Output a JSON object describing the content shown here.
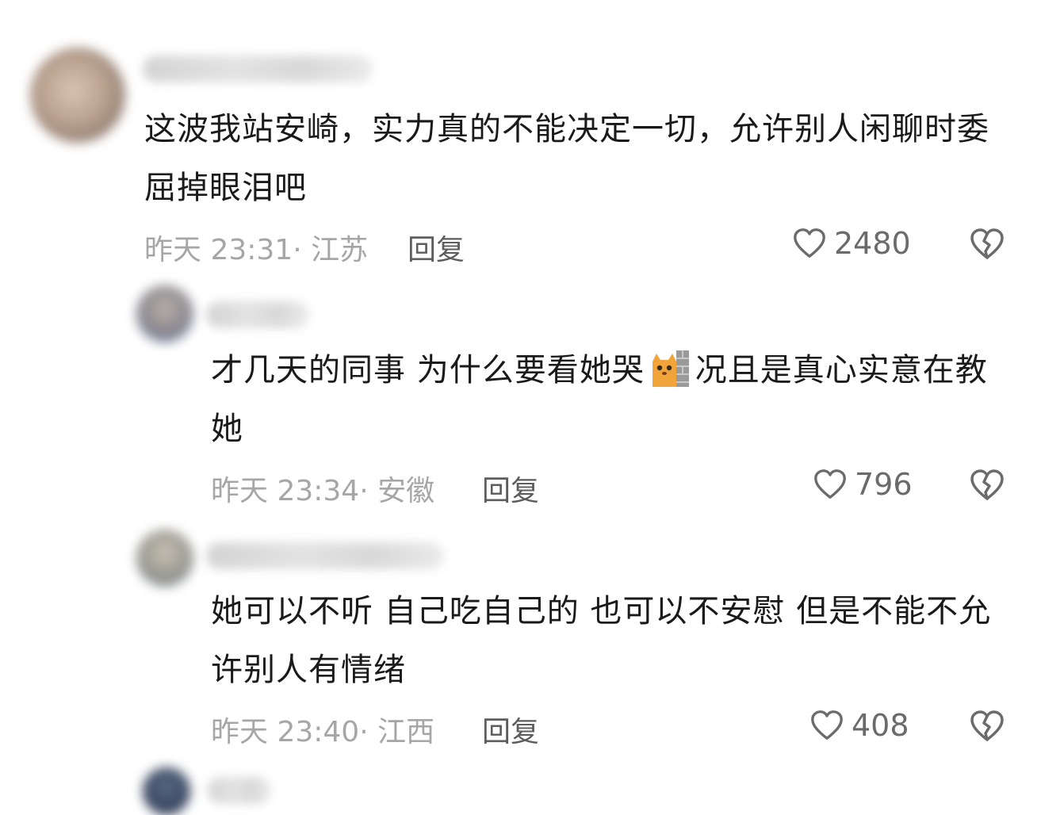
{
  "comments": [
    {
      "text": "这波我站安崎，实力真的不能决定一切，允许别人闲聊时委屈掉眼泪吧",
      "meta": "昨天 23:31· 江苏",
      "reply": "回复",
      "likes": "2480"
    },
    {
      "text_before": "才几天的同事 为什么要看她哭",
      "emoji": "cat-wall-emoji",
      "text_after": "况且是真心实意在教她",
      "meta": "昨天 23:34· 安徽",
      "reply": "回复",
      "likes": "796"
    },
    {
      "text": "她可以不听 自己吃自己的 也可以不安慰 但是不能不允许别人有情绪",
      "meta": "昨天 23:40· 江西",
      "reply": "回复",
      "likes": "408"
    }
  ],
  "icons": {
    "like": "heart-outline-icon",
    "dislike": "broken-heart-icon"
  },
  "colors": {
    "text": "#1a1a1a",
    "meta": "#a6a6a6",
    "reply": "#5d5d5d",
    "icon": "#6b6b6b"
  }
}
